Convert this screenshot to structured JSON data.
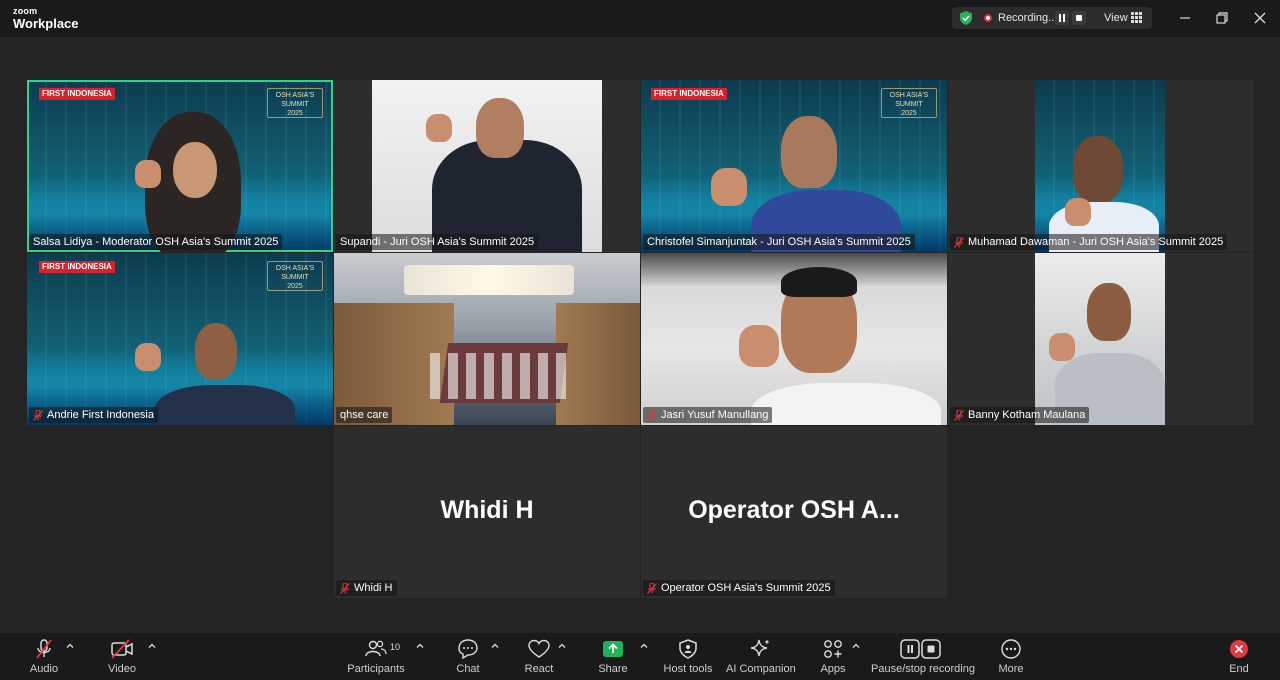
{
  "app": {
    "brand_top": "zoom",
    "brand_bottom": "Workplace"
  },
  "titlebar": {
    "recording_label": "Recording...",
    "view_label": "View"
  },
  "tiles": [
    {
      "name": "Salsa Lidiya - Moderator OSH Asia's Summit 2025",
      "muted": false,
      "active": true
    },
    {
      "name": "Supandi - Juri OSH Asia's Summit 2025",
      "muted": false,
      "active": false
    },
    {
      "name": "Christofel Simanjuntak - Juri OSH Asia's Summit 2025",
      "muted": false,
      "active": false
    },
    {
      "name": "Muhamad Dawaman - Juri OSH Asia's Summit 2025",
      "muted": true,
      "active": false
    },
    {
      "name": "Andrie First Indonesia",
      "muted": true,
      "active": false
    },
    {
      "name": "qhse care",
      "muted": false,
      "active": false
    },
    {
      "name": "Jasri Yusuf Manullang",
      "muted": true,
      "active": false
    },
    {
      "name": "Banny Kotham Maulana",
      "muted": true,
      "active": false
    },
    {
      "name": "Whidi H",
      "display_name": "Whidi H",
      "muted": true,
      "active": false
    },
    {
      "name": "Operator OSH Asia's Summit 2025",
      "display_name": "Operator OSH A...",
      "muted": true,
      "active": false
    }
  ],
  "branding": {
    "logo_text": "FIRST INDONESIA",
    "summit_line1": "OSH ASIA'S",
    "summit_line2": "SUMMIT",
    "summit_line3": "2025"
  },
  "toolbar": {
    "audio": "Audio",
    "video": "Video",
    "participants": "Participants",
    "participants_count": "10",
    "chat": "Chat",
    "react": "React",
    "share": "Share",
    "host_tools": "Host tools",
    "ai_companion": "AI Companion",
    "apps": "Apps",
    "pause_stop": "Pause/stop recording",
    "more": "More",
    "end": "End"
  },
  "colors": {
    "active_speaker": "#2bd38c",
    "share_green": "#1fb45a",
    "mute_red": "#e0393e",
    "end_red": "#e0393e"
  }
}
